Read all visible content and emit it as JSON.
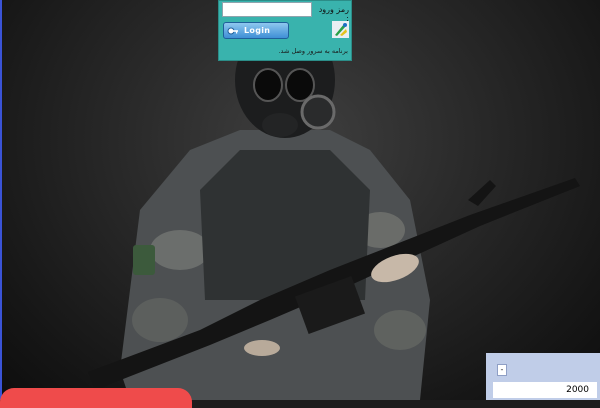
{
  "login": {
    "password_label": "رمز ورود :",
    "password_value": "",
    "button_label": "Login",
    "status_text": "برنامه به سرور وصل شد."
  },
  "counter": {
    "minus_label": "-",
    "value": "2000"
  },
  "colors": {
    "panel": "#39b3ad",
    "login_button": "#3f8fd6",
    "counter_panel": "#c0cde8",
    "red_tab": "#ef4b4b"
  }
}
